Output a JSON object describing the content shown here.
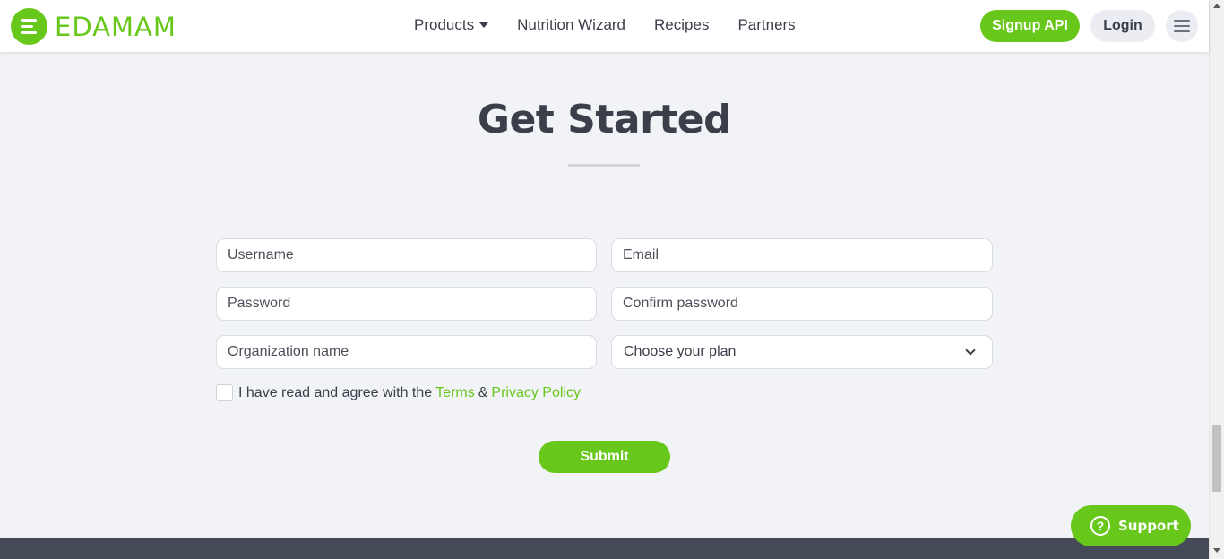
{
  "header": {
    "logo_text": "EDAMAM",
    "nav": [
      "Products",
      "Nutrition Wizard",
      "Recipes",
      "Partners"
    ],
    "signup_label": "Signup API",
    "login_label": "Login"
  },
  "main": {
    "title": "Get Started",
    "fields": {
      "username_placeholder": "Username",
      "email_placeholder": "Email",
      "password_placeholder": "Password",
      "confirm_password_placeholder": "Confirm password",
      "organization_placeholder": "Organization name",
      "plan_selected": "Choose your plan"
    },
    "agree": {
      "prefix": "I have read and agree with the",
      "terms": "Terms",
      "ampersand": "&",
      "privacy": "Privacy Policy"
    },
    "submit_label": "Submit"
  },
  "support": {
    "icon_glyph": "?",
    "label": "Support"
  },
  "colors": {
    "brand": "#67c71a",
    "text": "#3b3f4a",
    "background": "#f2f3f7",
    "footer": "#454a57"
  }
}
